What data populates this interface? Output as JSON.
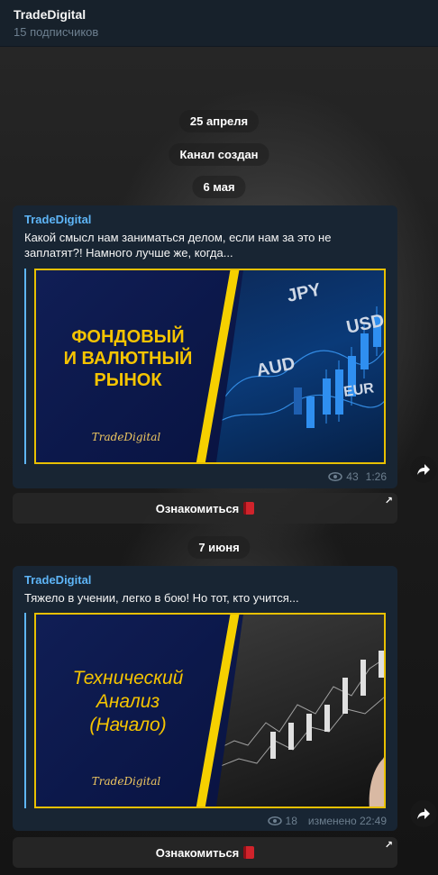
{
  "header": {
    "title": "TradeDigital",
    "subtitle": "15 подписчиков"
  },
  "service": {
    "date1": "25 апреля",
    "created": "Канал создан",
    "date2": "6 мая",
    "date3": "7 июня"
  },
  "posts": [
    {
      "author": "TradeDigital",
      "text": "Какой смысл нам заниматься делом, если нам за это не заплатят?! Намного лучше же, когда...",
      "banner": {
        "title_lines": [
          "ФОНДОВЫЙ",
          "И ВАЛЮТНЫЙ",
          "РЫНОК"
        ],
        "logo": "TradeDigital",
        "currencies": [
          "JPY",
          "USD",
          "AUD",
          "EUR"
        ]
      },
      "views": "43",
      "time": "1:26",
      "button_label": "Ознакомиться"
    },
    {
      "author": "TradeDigital",
      "text": "Тяжело в учении, легко в бою! Но тот, кто учится...",
      "banner": {
        "title_lines": [
          "Технический",
          "Анализ",
          "(Начало)"
        ],
        "logo": "TradeDigital"
      },
      "views": "18",
      "time": "изменено 22:49",
      "button_label": "Ознакомиться"
    }
  ],
  "icons": {
    "views": "eye-icon",
    "forward": "forward-arrow-icon",
    "link": "external-link-icon",
    "book": "red-book-emoji"
  },
  "colors": {
    "accent": "#5eb5f7",
    "bubble": "#182533",
    "banner_yellow": "#f5c400"
  }
}
